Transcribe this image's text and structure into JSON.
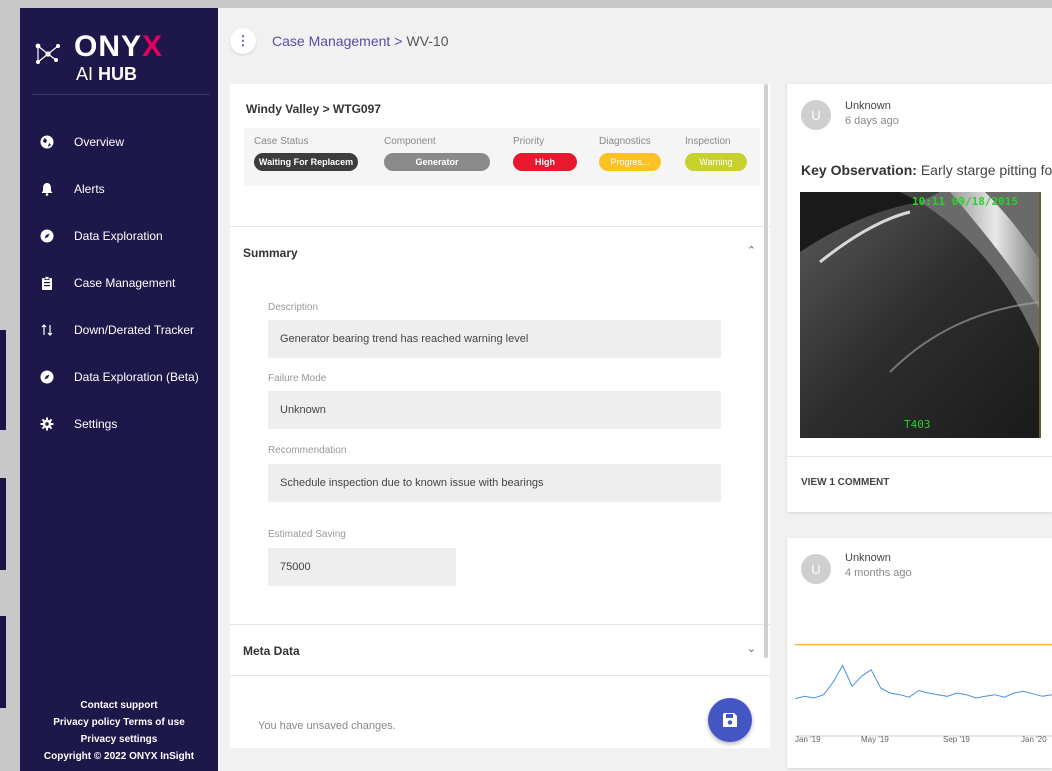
{
  "brand": {
    "name": "ONYX",
    "sub_prefix": "AI",
    "sub_bold": "HUB"
  },
  "sidebar": {
    "items": [
      {
        "label": "Overview",
        "icon": "globe-icon"
      },
      {
        "label": "Alerts",
        "icon": "bell-icon"
      },
      {
        "label": "Data Exploration",
        "icon": "compass-icon"
      },
      {
        "label": "Case Management",
        "icon": "clipboard-icon"
      },
      {
        "label": "Down/Derated Tracker",
        "icon": "arrows-updown-icon"
      },
      {
        "label": "Data Exploration (Beta)",
        "icon": "compass-icon"
      },
      {
        "label": "Settings",
        "icon": "gear-icon"
      }
    ],
    "footer": {
      "contact": "Contact support",
      "privacy_terms": "Privacy policy Terms of use",
      "privacy_settings": "Privacy settings",
      "copyright": "Copyright © 2022 ONYX InSight"
    }
  },
  "header": {
    "breadcrumb_root": "Case Management",
    "breadcrumb_sep": ">",
    "breadcrumb_current": "WV-10"
  },
  "case": {
    "title": "Windy Valley > WTG097",
    "statuses": [
      {
        "label": "Case Status",
        "value": "Waiting For Replacem",
        "bg": "#3d3d3d",
        "fg": "#ffffff"
      },
      {
        "label": "Component",
        "value": "Generator",
        "bg": "#8a8a8a",
        "fg": "#ffffff"
      },
      {
        "label": "Priority",
        "value": "High",
        "bg": "#e8182e",
        "fg": "#ffffff"
      },
      {
        "label": "Diagnostics",
        "value": "Progres...",
        "bg": "#fcc223",
        "fg": "#ffffff"
      },
      {
        "label": "Inspection",
        "value": "Warning",
        "bg": "#c6d12c",
        "fg": "#ffffff"
      }
    ]
  },
  "summary": {
    "title": "Summary",
    "description_label": "Description",
    "description": "Generator bearing trend has reached warning level",
    "failure_mode_label": "Failure Mode",
    "failure_mode": "Unknown",
    "recommendation_label": "Recommendation",
    "recommendation": "Schedule inspection due to known issue with bearings",
    "saving_label": "Estimated Saving",
    "saving": "75000"
  },
  "meta": {
    "title": "Meta Data"
  },
  "unsaved": "You have unsaved changes.",
  "posts": [
    {
      "avatar": "U",
      "author": "Unknown",
      "ago": "6 days ago",
      "key_label": "Key Observation:",
      "key_text": "Early starge pitting fou",
      "photo_timestamp": "10:11 09/18/2015",
      "photo_tag": "T403",
      "view_comments": "VIEW 1 COMMENT"
    },
    {
      "avatar": "U",
      "author": "Unknown",
      "ago": "4 months ago",
      "x_labels": [
        "Jan '19",
        "May '19",
        "Sep '19",
        "Jan '20"
      ]
    }
  ],
  "chart_data": {
    "type": "line",
    "x": [
      "Jan '19",
      "May '19",
      "Sep '19",
      "Jan '20"
    ],
    "series": [
      {
        "values": [
          0.35,
          0.38,
          0.36,
          0.4,
          0.55,
          0.75,
          0.5,
          0.62,
          0.7,
          0.48,
          0.42,
          0.4,
          0.37,
          0.45,
          0.42,
          0.4,
          0.38,
          0.42,
          0.4,
          0.36,
          0.38,
          0.4,
          0.37,
          0.42,
          0.44,
          0.41,
          0.38,
          0.4
        ],
        "color": "#4a90e2"
      },
      {
        "values": [
          1.0,
          1.0
        ],
        "color": "#f5a623"
      }
    ],
    "ylim": [
      0,
      1.2
    ]
  },
  "colors": {
    "sidebar": "#1d1849",
    "accent": "#5a4ba6",
    "fab": "#4456c4"
  }
}
